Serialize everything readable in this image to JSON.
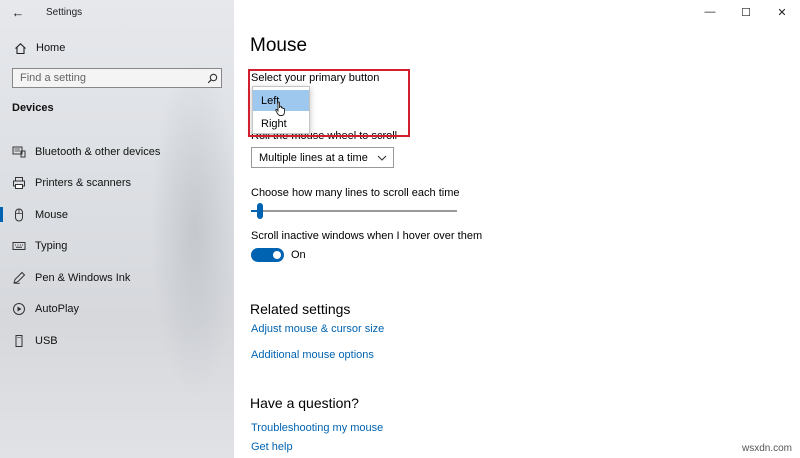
{
  "window": {
    "title": "Settings",
    "back_glyph": "←",
    "minimize_glyph": "—",
    "maximize_glyph": "☐",
    "close_glyph": "✕"
  },
  "sidebar": {
    "home_label": "Home",
    "search_placeholder": "Find a setting",
    "section_label": "Devices",
    "items": [
      {
        "label": "Bluetooth & other devices",
        "icon": "bluetooth-devices-icon"
      },
      {
        "label": "Printers & scanners",
        "icon": "printer-icon"
      },
      {
        "label": "Mouse",
        "icon": "mouse-icon",
        "selected": true
      },
      {
        "label": "Typing",
        "icon": "keyboard-icon"
      },
      {
        "label": "Pen & Windows Ink",
        "icon": "pen-icon"
      },
      {
        "label": "AutoPlay",
        "icon": "autoplay-icon"
      },
      {
        "label": "USB",
        "icon": "usb-icon"
      }
    ]
  },
  "main": {
    "title": "Mouse",
    "primary_button_label": "Select your primary button",
    "primary_button_options": [
      "Left",
      "Right"
    ],
    "primary_button_selected": "Left",
    "wheel_label": "Roll the mouse wheel to scroll",
    "wheel_value": "Multiple lines at a time",
    "lines_label": "Choose how many lines to scroll each time",
    "lines_value_fraction": 0.03,
    "inactive_label": "Scroll inactive windows when I hover over them",
    "inactive_state": "On",
    "related_title": "Related settings",
    "related_links": [
      "Adjust mouse & cursor size",
      "Additional mouse options"
    ],
    "question_title": "Have a question?",
    "question_links": [
      "Troubleshooting my mouse",
      "Get help"
    ]
  },
  "watermark": "wsxdn.com",
  "colors": {
    "accent": "#0063b1",
    "highlight_outline": "#d21f2e",
    "selected_option": "#9fc8ef"
  }
}
